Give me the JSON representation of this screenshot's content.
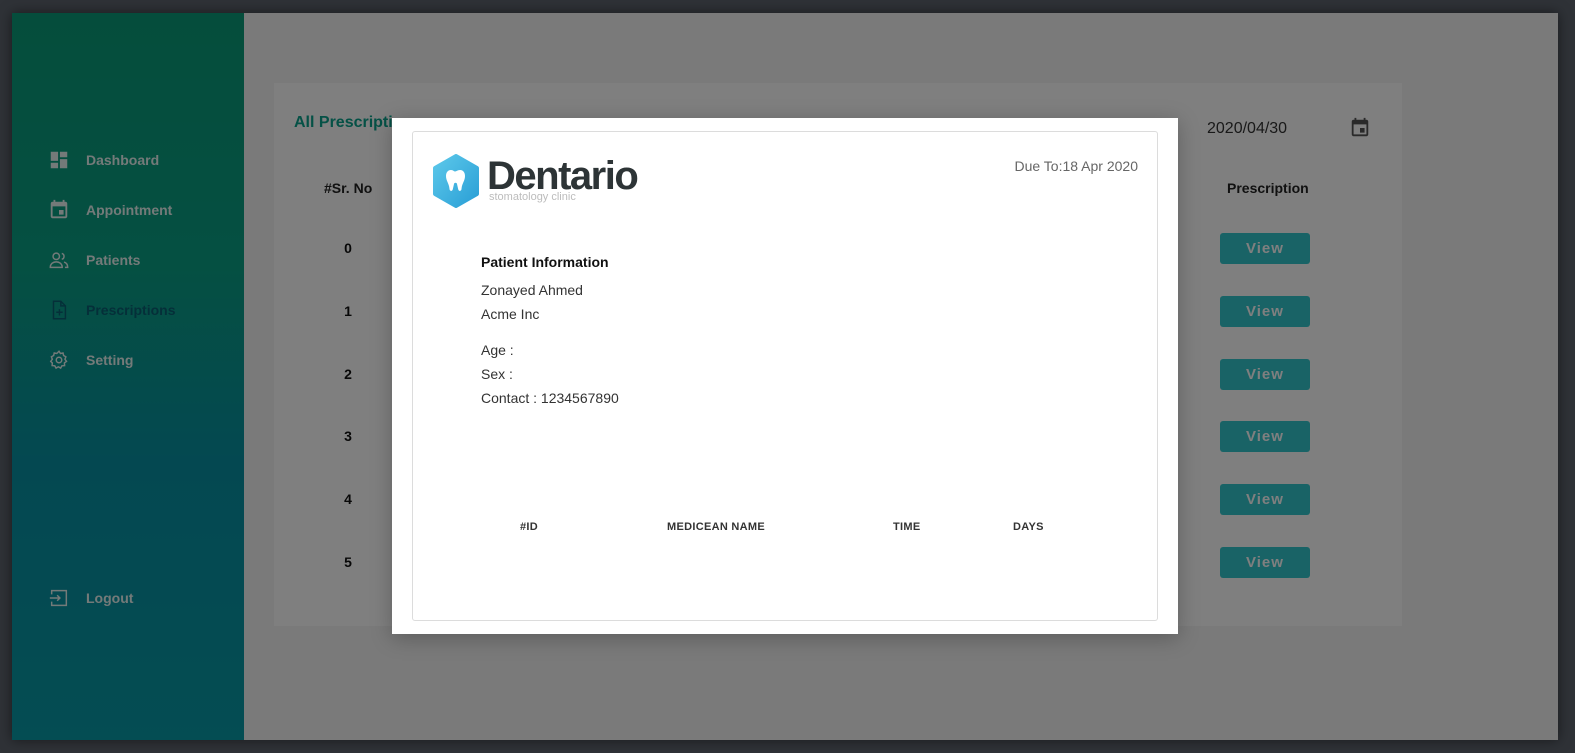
{
  "sidebar": {
    "items": [
      {
        "label": "Dashboard",
        "icon": "dashboard-icon"
      },
      {
        "label": "Appointment",
        "icon": "calendar-icon"
      },
      {
        "label": "Patients",
        "icon": "people-icon"
      },
      {
        "label": "Prescriptions",
        "icon": "prescription-file-icon",
        "active": true
      },
      {
        "label": "Setting",
        "icon": "gear-icon"
      }
    ],
    "logout": {
      "label": "Logout",
      "icon": "logout-icon"
    }
  },
  "main": {
    "title": "All Prescriptions",
    "date_value": "2020/04/30",
    "columns": {
      "sr_no": "#Sr. No",
      "prescription": "Prescription"
    },
    "rows": [
      {
        "sr": "0",
        "action": "View"
      },
      {
        "sr": "1",
        "action": "View"
      },
      {
        "sr": "2",
        "action": "View"
      },
      {
        "sr": "3",
        "action": "View"
      },
      {
        "sr": "4",
        "action": "View"
      },
      {
        "sr": "5",
        "action": "View"
      }
    ]
  },
  "modal": {
    "brand": {
      "name": "Dentario",
      "tagline": "stomatology clinic"
    },
    "due": "Due To:18 Apr 2020",
    "patient": {
      "heading": "Patient Information",
      "name": "Zonayed Ahmed",
      "company": "Acme Inc",
      "age": "Age :",
      "sex": "Sex :",
      "contact": "Contact : 1234567890"
    },
    "table_headers": {
      "id": "#ID",
      "medicine": "MEDICEAN NAME",
      "time": "TIME",
      "days": "DAYS"
    }
  },
  "colors": {
    "accent": "#0aa38c",
    "button": "#33c7cc",
    "active_nav": "#0b5f72"
  }
}
